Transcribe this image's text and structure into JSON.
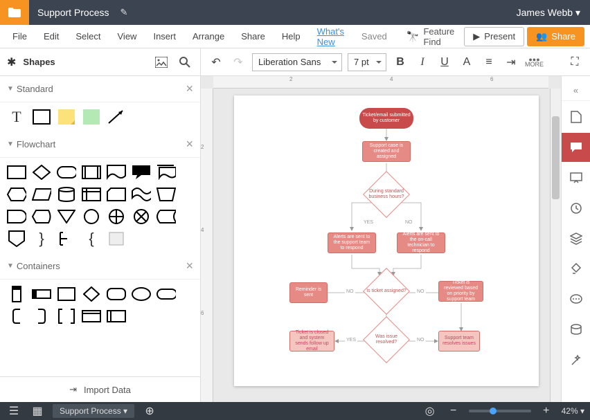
{
  "titlebar": {
    "doc_title": "Support Process",
    "user": "James Webb ▾"
  },
  "menubar": {
    "items": [
      "File",
      "Edit",
      "Select",
      "View",
      "Insert",
      "Arrange",
      "Share",
      "Help"
    ],
    "whats_new": "What's New",
    "saved": "Saved",
    "feature_find": "Feature Find",
    "present": "Present",
    "share": "Share"
  },
  "toolbar": {
    "shapes_label": "Shapes",
    "font": "Liberation Sans",
    "font_size": "7 pt",
    "more_label": "MORE"
  },
  "left_panel": {
    "sections": [
      {
        "title": "Standard"
      },
      {
        "title": "Flowchart"
      },
      {
        "title": "Containers"
      }
    ],
    "import_data": "Import Data"
  },
  "right_dock": {
    "icons": [
      "page-icon",
      "comment-icon",
      "presentation-icon",
      "history-icon",
      "layers-icon",
      "paint-icon",
      "chat-icon",
      "data-icon",
      "magic-icon"
    ]
  },
  "bottombar": {
    "tab": "Support Process ▾",
    "zoom": "42% ▾"
  },
  "diagram": {
    "nodes": {
      "start": "Ticket/email\nsubmitted by\ncustomer",
      "create": "Support case is\ncreated and\nassigned",
      "hours": "During\nstandard\nbusiness hours?",
      "alert_team": "Alerts are sent\nto the support team\nto respond",
      "alert_oncall": "Alerts are sent to\nthe on-call\ntechnician to\nrespond",
      "assigned": "Is ticket\nassigned?",
      "reminder": "Reminder is sent",
      "review": "Ticket is reviewed\nbased on priority\nby support team",
      "resolved": "Was\nissue\nresolved?",
      "close": "Ticket is closed\nand system sends\nfollow up email",
      "team_resolve": "Support\nteam resolves\nissues"
    },
    "labels": {
      "yes": "YES",
      "no": "NO"
    }
  },
  "ruler": {
    "h": [
      "2",
      "4",
      "6"
    ],
    "v": [
      "2",
      "4",
      "6"
    ]
  },
  "chart_data": {
    "type": "flowchart",
    "title": "Support Process",
    "nodes": [
      {
        "id": "start",
        "type": "terminator",
        "label": "Ticket/email submitted by customer"
      },
      {
        "id": "create",
        "type": "process",
        "label": "Support case is created and assigned"
      },
      {
        "id": "hours",
        "type": "decision",
        "label": "During standard business hours?"
      },
      {
        "id": "alert_team",
        "type": "process",
        "label": "Alerts are sent to the support team to respond"
      },
      {
        "id": "alert_oncall",
        "type": "process",
        "label": "Alerts are sent to the on-call technician to respond"
      },
      {
        "id": "assigned",
        "type": "decision",
        "label": "Is ticket assigned?"
      },
      {
        "id": "reminder",
        "type": "process",
        "label": "Reminder is sent"
      },
      {
        "id": "review",
        "type": "process",
        "label": "Ticket is reviewed based on priority by support team"
      },
      {
        "id": "resolved",
        "type": "decision",
        "label": "Was issue resolved?"
      },
      {
        "id": "close",
        "type": "process",
        "label": "Ticket is closed and system sends follow up email"
      },
      {
        "id": "team_resolve",
        "type": "process",
        "label": "Support team resolves issues"
      }
    ],
    "edges": [
      {
        "from": "start",
        "to": "create"
      },
      {
        "from": "create",
        "to": "hours"
      },
      {
        "from": "hours",
        "to": "alert_team",
        "label": "YES"
      },
      {
        "from": "hours",
        "to": "alert_oncall",
        "label": "NO"
      },
      {
        "from": "alert_team",
        "to": "assigned"
      },
      {
        "from": "alert_oncall",
        "to": "assigned"
      },
      {
        "from": "assigned",
        "to": "reminder",
        "label": "NO"
      },
      {
        "from": "assigned",
        "to": "review",
        "label": "NO"
      },
      {
        "from": "assigned",
        "to": "resolved",
        "label": "YES"
      },
      {
        "from": "resolved",
        "to": "close",
        "label": "YES"
      },
      {
        "from": "resolved",
        "to": "team_resolve",
        "label": "NO"
      },
      {
        "from": "review",
        "to": "team_resolve"
      }
    ]
  }
}
